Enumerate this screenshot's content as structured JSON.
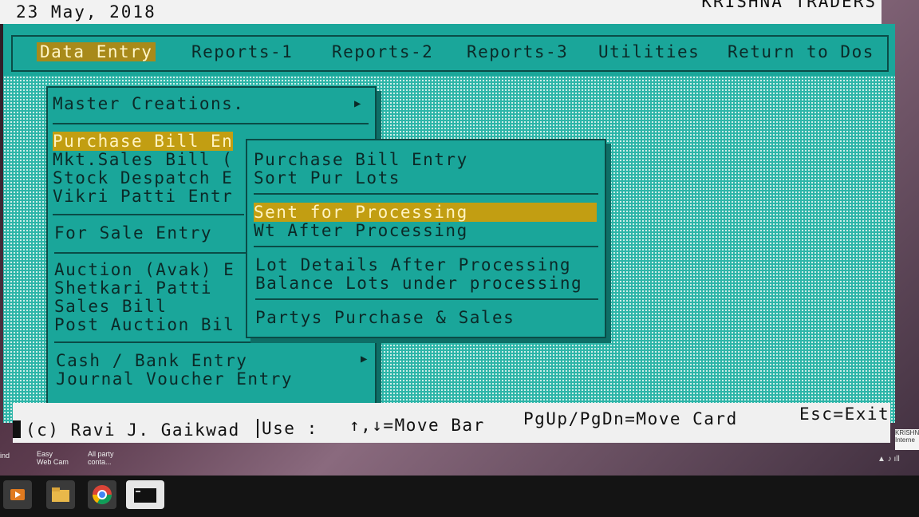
{
  "top": {
    "date": "23 May, 2018",
    "company": "KRISHNA TRADERS"
  },
  "menubar": {
    "items": [
      "Data Entry",
      "Reports-1",
      "Reports-2",
      "Reports-3",
      "Utilities",
      "Return to Dos"
    ],
    "active": "Data Entry"
  },
  "main_card": {
    "item_master": "Master Creations.",
    "item_purchase": "Purchase Bill En",
    "item_mkt_sales": "Mkt.Sales Bill (",
    "item_stock": "Stock Despatch E",
    "item_vikri": "Vikri Patti Entr",
    "item_for_sale": "For Sale Entry",
    "item_auction": "Auction (Avak) E",
    "item_shetkari": "Shetkari Patti",
    "item_sales_bill": "Sales Bill",
    "item_post_auction": "Post Auction Bil",
    "item_cash_bank": "Cash / Bank Entry",
    "item_journal": "Journal Voucher Entry"
  },
  "sub_card": {
    "item_purchase_entry": "Purchase Bill Entry",
    "item_sort": "Sort Pur Lots",
    "item_sent": "Sent for Processing",
    "item_wt_after": "Wt After Processing",
    "item_lot_details": "Lot Details After Processing",
    "item_balance": "Balance Lots under processing",
    "item_partys": "Partys Purchase & Sales"
  },
  "status": {
    "copyright": "(c) Ravi J. Gaikwad",
    "use": "Use :",
    "move_bar": "↑,↓=Move Bar",
    "move_card": "PgUp/PgDn=Move Card",
    "exit": "Esc=Exit"
  },
  "desktop": {
    "icon1": "ind",
    "icon2": "Easy Web Cam",
    "icon3": "All party conta...",
    "tray_label": "KRISHN Interne"
  },
  "colors": {
    "screen": "#1aa69a",
    "highlight": "#c29e12",
    "border": "#0a4c47"
  }
}
